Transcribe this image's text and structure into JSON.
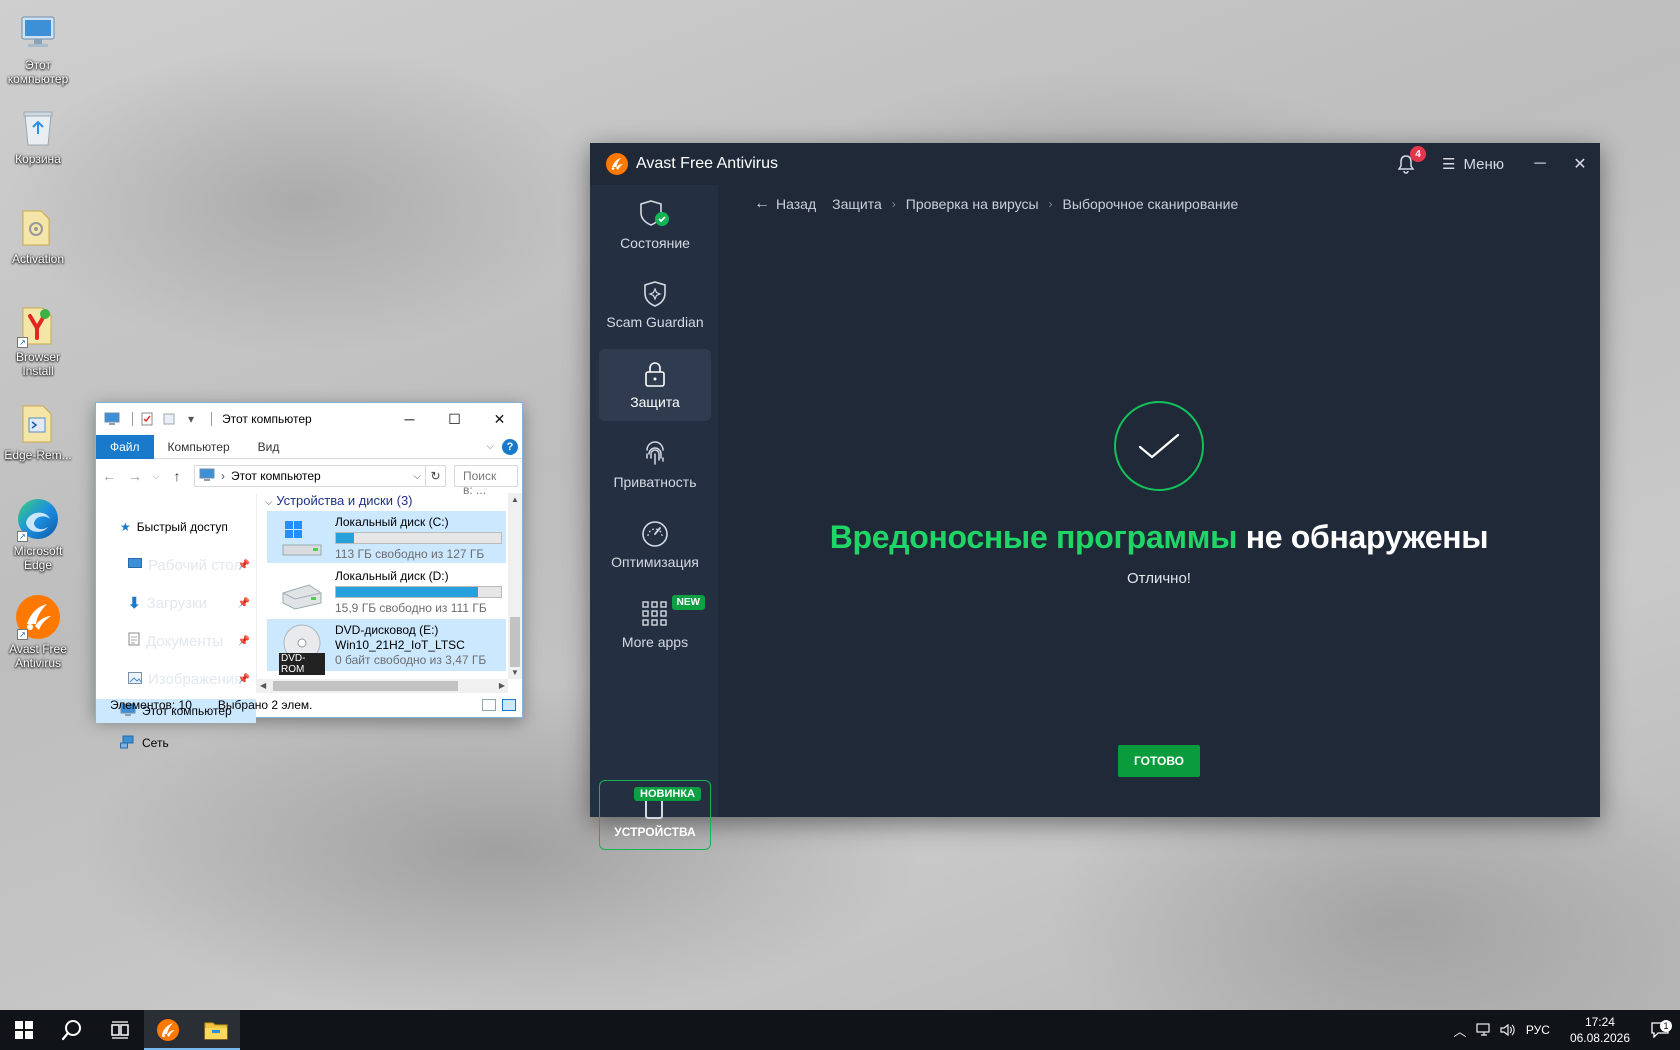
{
  "desktop": {
    "icons": [
      {
        "label": "Этот компьютер",
        "icon": "computer-icon"
      },
      {
        "label": "Корзина",
        "icon": "recycle-bin-icon"
      },
      {
        "label": "Activation",
        "icon": "folder-icon"
      },
      {
        "label": "Browser Install",
        "icon": "yandex-browser-icon"
      },
      {
        "label": "Edge-Rem...",
        "icon": "script-file-icon"
      },
      {
        "label": "Microsoft Edge",
        "icon": "edge-icon"
      },
      {
        "label": "Avast Free Antivirus",
        "icon": "avast-icon"
      }
    ]
  },
  "explorer": {
    "title": "Этот компьютер",
    "ribbon": {
      "file": "Файл",
      "computer": "Компьютер",
      "view": "Вид",
      "help": "?"
    },
    "address": "Этот компьютер",
    "search_placeholder": "Поиск в: ...",
    "nav": {
      "quick_access": "Быстрый доступ",
      "desktop": "Рабочий стол",
      "downloads": "Загрузки",
      "documents": "Документы",
      "pictures": "Изображения",
      "this_pc": "Этот компьютер",
      "network": "Сеть"
    },
    "group_header": "Устройства и диски (3)",
    "drives": [
      {
        "name": "Локальный диск (C:)",
        "free": "113 ГБ свободно из 127 ГБ",
        "used_fraction": 0.11,
        "selected": true
      },
      {
        "name": "Локальный диск (D:)",
        "free": "15,9 ГБ свободно из 111 ГБ",
        "used_fraction": 0.86,
        "selected": false
      },
      {
        "name": "DVD-дисковод (E:)",
        "volume": "Win10_21H2_IoT_LTSC",
        "free": "0 байт свободно из 3,47 ГБ",
        "overlay": "DVD-ROM",
        "selected": true
      }
    ],
    "status": {
      "items": "Элементов: 10",
      "selected": "Выбрано 2 элем."
    }
  },
  "avast": {
    "title": "Avast Free Antivirus",
    "notifications_count": "4",
    "menu_label": "Меню",
    "sidebar": [
      {
        "label": "Состояние",
        "icon": "shield-check-icon",
        "active": false
      },
      {
        "label": "Scam Guardian",
        "icon": "scam-guardian-icon",
        "active": false
      },
      {
        "label": "Защита",
        "icon": "lock-icon",
        "active": true
      },
      {
        "label": "Приватность",
        "icon": "fingerprint-icon",
        "active": false
      },
      {
        "label": "Оптимизация",
        "icon": "gauge-icon",
        "active": false
      },
      {
        "label": "More apps",
        "icon": "apps-grid-icon",
        "active": false,
        "badge": "NEW"
      }
    ],
    "devices": {
      "label": "УСТРОЙСТВА",
      "badge": "НОВИНКА"
    },
    "breadcrumb": {
      "back": "Назад",
      "items": [
        "Защита",
        "Проверка на вирусы",
        "Выборочное сканирование"
      ]
    },
    "result": {
      "headline_green": "Вредоносные программы",
      "headline_white": "не обнаружены",
      "subtitle": "Отлично!"
    },
    "done_button": "ГОТОВО",
    "colors": {
      "bg": "#1f2938",
      "sidebar": "#243041",
      "accent_green": "#1fd565",
      "button_green": "#099b3c",
      "logo_orange": "#ff7800",
      "badge_red": "#e5364b"
    }
  },
  "taskbar": {
    "apps": [
      "start-icon",
      "search-icon",
      "task-view-icon",
      "avast-icon",
      "file-explorer-icon"
    ],
    "tray": {
      "language": "РУС",
      "time": "17:24",
      "date": "06.08.2026",
      "notification_count": "1"
    }
  }
}
